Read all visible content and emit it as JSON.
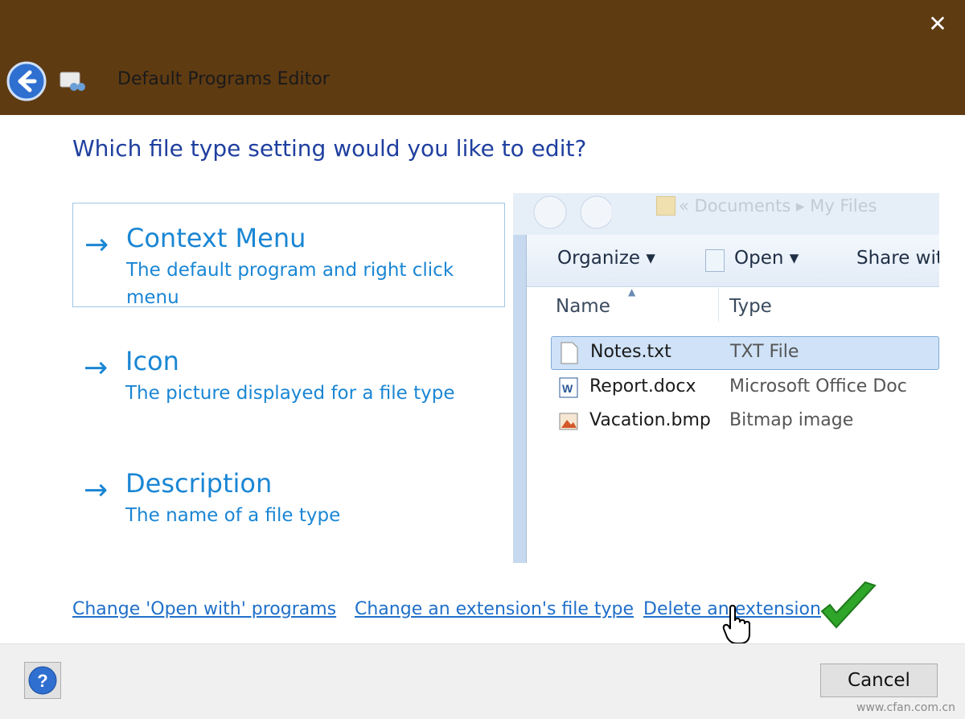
{
  "window": {
    "title": "Default Programs Editor",
    "close_glyph": "✕"
  },
  "heading": "Which file type setting would you like to edit?",
  "options": [
    {
      "title": "Context Menu",
      "desc": "The default program and right click menu",
      "arrow": "→"
    },
    {
      "title": "Icon",
      "desc": "The picture displayed for a file type",
      "arrow": "→"
    },
    {
      "title": "Description",
      "desc": "The name of a file type",
      "arrow": "→"
    }
  ],
  "explorer": {
    "breadcrumb": "« Documents ▸ My Files",
    "toolbar": {
      "organize": "Organize ▾",
      "open": "Open ▾",
      "share": "Share with"
    },
    "columns": {
      "name": "Name",
      "type": "Type"
    },
    "files": [
      {
        "name": "Notes.txt",
        "type": "TXT File"
      },
      {
        "name": "Report.docx",
        "type": "Microsoft Office Doc"
      },
      {
        "name": "Vacation.bmp",
        "type": "Bitmap image"
      }
    ]
  },
  "links": {
    "open_with": "Change 'Open with' programs",
    "extension_type": "Change an extension's file type",
    "delete_extension": "Delete an extension"
  },
  "footer": {
    "help": "?",
    "cancel": "Cancel"
  },
  "watermark": "www.cfan.com.cn",
  "colors": {
    "titlebar": "#5f3b12",
    "accent": "#1a86d4",
    "heading": "#1f3f9f",
    "link": "#1f6fc9",
    "check": "#2fa52a"
  }
}
